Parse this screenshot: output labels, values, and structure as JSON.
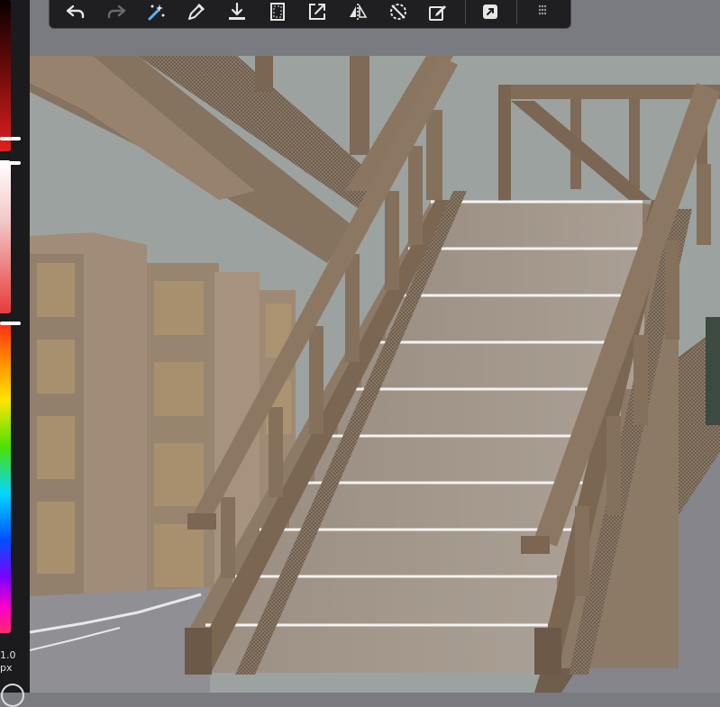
{
  "colors": {
    "panel_bg": "#1b1b1d",
    "toolbar_bg": "#1f1f21",
    "wall": "#9ba19e",
    "stair_tread": "#a29689",
    "wood": "#82705c",
    "floor": "#8e8e93"
  },
  "toolbar": {
    "tools": [
      {
        "name": "undo-icon",
        "enabled": true
      },
      {
        "name": "redo-icon",
        "enabled": false
      },
      {
        "name": "magic-select-icon",
        "enabled": true
      },
      {
        "name": "eyedropper-icon",
        "enabled": true
      },
      {
        "name": "download-icon",
        "enabled": true
      },
      {
        "name": "canvas-frame-icon",
        "enabled": true
      },
      {
        "name": "export-icon",
        "enabled": true
      },
      {
        "name": "flip-horizontal-icon",
        "enabled": true
      },
      {
        "name": "rotate-dashed-icon",
        "enabled": true
      },
      {
        "name": "edit-layer-icon",
        "enabled": true
      },
      {
        "name": "share-icon",
        "enabled": true
      },
      {
        "name": "grid-menu-icon",
        "enabled": true
      }
    ]
  },
  "brush": {
    "size_value": "1.0",
    "size_unit": "px"
  },
  "color_sliders": {
    "red_level": 0.91,
    "lightness_level": 0.0,
    "hue_level": 0.0
  }
}
